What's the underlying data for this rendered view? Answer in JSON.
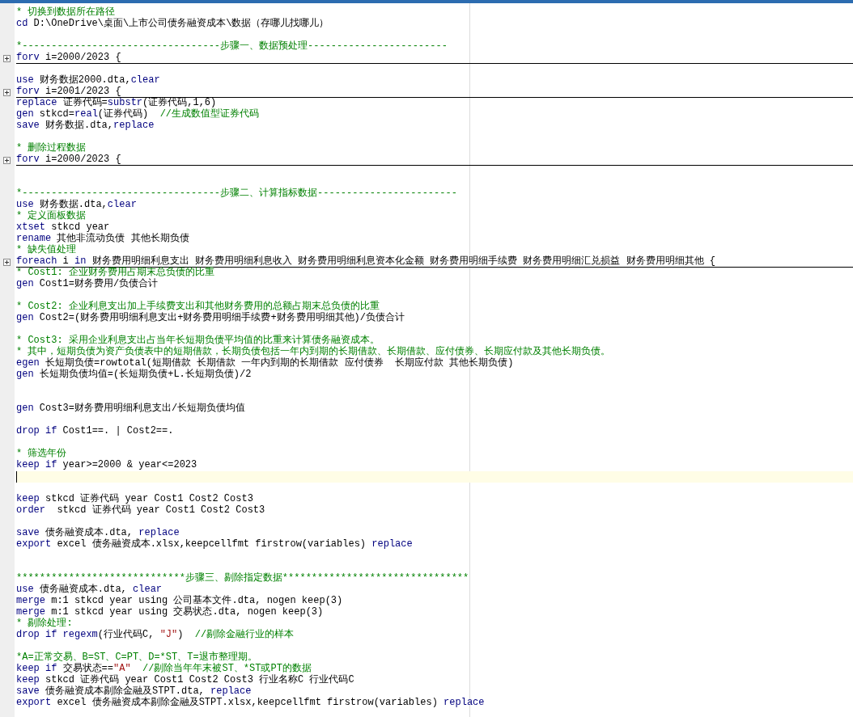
{
  "editor": {
    "lines": [
      {
        "kind": "code",
        "collapsed": false,
        "current": false,
        "segments": [
          {
            "kind": "comment",
            "text": "* 切换到数据所在路径"
          }
        ]
      },
      {
        "kind": "code",
        "collapsed": false,
        "current": false,
        "segments": [
          {
            "kind": "keyword",
            "text": "cd"
          },
          {
            "kind": "text",
            "text": " D:\\OneDrive\\桌面\\上市公司债务融资成本\\数据（存哪儿找哪儿）"
          }
        ]
      },
      {
        "kind": "blank",
        "current": false
      },
      {
        "kind": "code",
        "collapsed": false,
        "current": false,
        "segments": [
          {
            "kind": "comment",
            "text": "*----------------------------------步骤一、数据预处理------------------------"
          }
        ]
      },
      {
        "kind": "code",
        "collapsed": true,
        "current": false,
        "segments": [
          {
            "kind": "keyword",
            "text": "forv"
          },
          {
            "kind": "text",
            "text": " i=2000/2023 {"
          }
        ]
      },
      {
        "kind": "blank",
        "current": false
      },
      {
        "kind": "code",
        "collapsed": false,
        "current": false,
        "segments": [
          {
            "kind": "keyword",
            "text": "use"
          },
          {
            "kind": "text",
            "text": " 财务数据2000.dta,"
          },
          {
            "kind": "keyword",
            "text": "clear"
          }
        ]
      },
      {
        "kind": "code",
        "collapsed": true,
        "current": false,
        "segments": [
          {
            "kind": "keyword",
            "text": "forv"
          },
          {
            "kind": "text",
            "text": " i=2001/2023 {"
          }
        ]
      },
      {
        "kind": "code",
        "collapsed": false,
        "current": false,
        "segments": [
          {
            "kind": "keyword",
            "text": "replace"
          },
          {
            "kind": "text",
            "text": " 证券代码="
          },
          {
            "kind": "keyword",
            "text": "substr"
          },
          {
            "kind": "text",
            "text": "(证券代码,1,6)"
          }
        ]
      },
      {
        "kind": "code",
        "collapsed": false,
        "current": false,
        "segments": [
          {
            "kind": "keyword",
            "text": "gen"
          },
          {
            "kind": "text",
            "text": " stkcd="
          },
          {
            "kind": "keyword",
            "text": "real"
          },
          {
            "kind": "text",
            "text": "(证券代码)  "
          },
          {
            "kind": "comment",
            "text": "//生成数值型证券代码"
          }
        ]
      },
      {
        "kind": "code",
        "collapsed": false,
        "current": false,
        "segments": [
          {
            "kind": "keyword",
            "text": "save"
          },
          {
            "kind": "text",
            "text": " 财务数据.dta,"
          },
          {
            "kind": "keyword",
            "text": "replace"
          }
        ]
      },
      {
        "kind": "blank",
        "current": false
      },
      {
        "kind": "code",
        "collapsed": false,
        "current": false,
        "segments": [
          {
            "kind": "comment",
            "text": "* 删除过程数据"
          }
        ]
      },
      {
        "kind": "code",
        "collapsed": true,
        "current": false,
        "segments": [
          {
            "kind": "keyword",
            "text": "forv"
          },
          {
            "kind": "text",
            "text": " i=2000/2023 {"
          }
        ]
      },
      {
        "kind": "blank",
        "current": false
      },
      {
        "kind": "blank",
        "current": false
      },
      {
        "kind": "code",
        "collapsed": false,
        "current": false,
        "segments": [
          {
            "kind": "comment",
            "text": "*----------------------------------步骤二、计算指标数据------------------------"
          }
        ]
      },
      {
        "kind": "code",
        "collapsed": false,
        "current": false,
        "segments": [
          {
            "kind": "keyword",
            "text": "use"
          },
          {
            "kind": "text",
            "text": " 财务数据.dta,"
          },
          {
            "kind": "keyword",
            "text": "clear"
          }
        ]
      },
      {
        "kind": "code",
        "collapsed": false,
        "current": false,
        "segments": [
          {
            "kind": "comment",
            "text": "* 定义面板数据"
          }
        ]
      },
      {
        "kind": "code",
        "collapsed": false,
        "current": false,
        "segments": [
          {
            "kind": "keyword",
            "text": "xtset"
          },
          {
            "kind": "text",
            "text": " stkcd year"
          }
        ]
      },
      {
        "kind": "code",
        "collapsed": false,
        "current": false,
        "segments": [
          {
            "kind": "keyword",
            "text": "rename"
          },
          {
            "kind": "text",
            "text": " 其他非流动负债 其他长期负债"
          }
        ]
      },
      {
        "kind": "code",
        "collapsed": false,
        "current": false,
        "segments": [
          {
            "kind": "comment",
            "text": "* 缺失值处理"
          }
        ]
      },
      {
        "kind": "code",
        "collapsed": true,
        "current": false,
        "segments": [
          {
            "kind": "keyword",
            "text": "foreach"
          },
          {
            "kind": "text",
            "text": " i "
          },
          {
            "kind": "keyword",
            "text": "in"
          },
          {
            "kind": "text",
            "text": " 财务费用明细利息支出 财务费用明细利息收入 财务费用明细利息资本化金额 财务费用明细手续费 财务费用明细汇兑损益 财务费用明细其他 {"
          }
        ]
      },
      {
        "kind": "code",
        "collapsed": false,
        "current": false,
        "segments": [
          {
            "kind": "comment",
            "text": "* Cost1: 企业财务费用占期末总负债的比重"
          }
        ]
      },
      {
        "kind": "code",
        "collapsed": false,
        "current": false,
        "segments": [
          {
            "kind": "keyword",
            "text": "gen"
          },
          {
            "kind": "text",
            "text": " Cost1=财务费用/负债合计"
          }
        ]
      },
      {
        "kind": "blank",
        "current": false
      },
      {
        "kind": "code",
        "collapsed": false,
        "current": false,
        "segments": [
          {
            "kind": "comment",
            "text": "* Cost2: 企业利息支出加上手续费支出和其他财务费用的总额占期末总负债的比重"
          }
        ]
      },
      {
        "kind": "code",
        "collapsed": false,
        "current": false,
        "segments": [
          {
            "kind": "keyword",
            "text": "gen"
          },
          {
            "kind": "text",
            "text": " Cost2=(财务费用明细利息支出+财务费用明细手续费+财务费用明细其他)/负债合计"
          }
        ]
      },
      {
        "kind": "blank",
        "current": false
      },
      {
        "kind": "code",
        "collapsed": false,
        "current": false,
        "segments": [
          {
            "kind": "comment",
            "text": "* Cost3: 采用企业利息支出占当年长短期负债平均值的比重来计算债务融资成本。"
          }
        ]
      },
      {
        "kind": "code",
        "collapsed": false,
        "current": false,
        "segments": [
          {
            "kind": "comment",
            "text": "* 其中，短期负债为资产负债表中的短期借款，长期负债包括一年内到期的长期借款、长期借款、应付债券、长期应付款及其他长期负债。"
          }
        ]
      },
      {
        "kind": "code",
        "collapsed": false,
        "current": false,
        "segments": [
          {
            "kind": "keyword",
            "text": "egen"
          },
          {
            "kind": "text",
            "text": " 长短期负债=rowtotal(短期借款 长期借款 一年内到期的长期借款 应付债券  长期应付款 其他长期负债)"
          }
        ]
      },
      {
        "kind": "code",
        "collapsed": false,
        "current": false,
        "segments": [
          {
            "kind": "keyword",
            "text": "gen"
          },
          {
            "kind": "text",
            "text": " 长短期负债均值=(长短期负债+L.长短期负债)/2"
          }
        ]
      },
      {
        "kind": "blank",
        "current": false
      },
      {
        "kind": "blank",
        "current": false
      },
      {
        "kind": "code",
        "collapsed": false,
        "current": false,
        "segments": [
          {
            "kind": "keyword",
            "text": "gen"
          },
          {
            "kind": "text",
            "text": " Cost3=财务费用明细利息支出/长短期负债均值"
          }
        ]
      },
      {
        "kind": "blank",
        "current": false
      },
      {
        "kind": "code",
        "collapsed": false,
        "current": false,
        "segments": [
          {
            "kind": "keyword",
            "text": "drop if"
          },
          {
            "kind": "text",
            "text": " Cost1==. | Cost2==."
          }
        ]
      },
      {
        "kind": "blank",
        "current": false
      },
      {
        "kind": "code",
        "collapsed": false,
        "current": false,
        "segments": [
          {
            "kind": "comment",
            "text": "* 筛选年份"
          }
        ]
      },
      {
        "kind": "code",
        "collapsed": false,
        "current": false,
        "segments": [
          {
            "kind": "keyword",
            "text": "keep if"
          },
          {
            "kind": "text",
            "text": " year>=2000 & year<=2023"
          }
        ]
      },
      {
        "kind": "blank",
        "current": true
      },
      {
        "kind": "blank",
        "current": false
      },
      {
        "kind": "code",
        "collapsed": false,
        "current": false,
        "segments": [
          {
            "kind": "keyword",
            "text": "keep"
          },
          {
            "kind": "text",
            "text": " stkcd 证券代码 year Cost1 Cost2 Cost3"
          }
        ]
      },
      {
        "kind": "code",
        "collapsed": false,
        "current": false,
        "segments": [
          {
            "kind": "keyword",
            "text": "order"
          },
          {
            "kind": "text",
            "text": "  stkcd 证券代码 year Cost1 Cost2 Cost3"
          }
        ]
      },
      {
        "kind": "blank",
        "current": false
      },
      {
        "kind": "code",
        "collapsed": false,
        "current": false,
        "segments": [
          {
            "kind": "keyword",
            "text": "save"
          },
          {
            "kind": "text",
            "text": " 债务融资成本.dta, "
          },
          {
            "kind": "keyword",
            "text": "replace"
          }
        ]
      },
      {
        "kind": "code",
        "collapsed": false,
        "current": false,
        "segments": [
          {
            "kind": "keyword",
            "text": "export"
          },
          {
            "kind": "text",
            "text": " excel 债务融资成本.xlsx,keepcellfmt firstrow(variables) "
          },
          {
            "kind": "keyword",
            "text": "replace"
          }
        ]
      },
      {
        "kind": "blank",
        "current": false
      },
      {
        "kind": "blank",
        "current": false
      },
      {
        "kind": "code",
        "collapsed": false,
        "current": false,
        "segments": [
          {
            "kind": "comment",
            "text": "*****************************步骤三、剔除指定数据********************************"
          }
        ]
      },
      {
        "kind": "code",
        "collapsed": false,
        "current": false,
        "segments": [
          {
            "kind": "keyword",
            "text": "use"
          },
          {
            "kind": "text",
            "text": " 债务融资成本.dta, "
          },
          {
            "kind": "keyword",
            "text": "clear"
          }
        ]
      },
      {
        "kind": "code",
        "collapsed": false,
        "current": false,
        "segments": [
          {
            "kind": "keyword",
            "text": "merge"
          },
          {
            "kind": "text",
            "text": " m:1 stkcd year using 公司基本文件.dta, nogen keep(3)"
          }
        ]
      },
      {
        "kind": "code",
        "collapsed": false,
        "current": false,
        "segments": [
          {
            "kind": "keyword",
            "text": "merge"
          },
          {
            "kind": "text",
            "text": " m:1 stkcd year using 交易状态.dta, nogen keep(3)"
          }
        ]
      },
      {
        "kind": "code",
        "collapsed": false,
        "current": false,
        "segments": [
          {
            "kind": "comment",
            "text": "* 剔除处理:"
          }
        ]
      },
      {
        "kind": "code",
        "collapsed": false,
        "current": false,
        "segments": [
          {
            "kind": "keyword",
            "text": "drop if regexm"
          },
          {
            "kind": "text",
            "text": "(行业代码C, "
          },
          {
            "kind": "string",
            "text": "\"J\""
          },
          {
            "kind": "text",
            "text": ")  "
          },
          {
            "kind": "comment",
            "text": "//剔除金融行业的样本"
          }
        ]
      },
      {
        "kind": "blank",
        "current": false
      },
      {
        "kind": "code",
        "collapsed": false,
        "current": false,
        "segments": [
          {
            "kind": "comment",
            "text": "*A=正常交易、B=ST、C=PT、D=*ST、T=退市整理期。"
          }
        ]
      },
      {
        "kind": "code",
        "collapsed": false,
        "current": false,
        "segments": [
          {
            "kind": "keyword",
            "text": "keep if"
          },
          {
            "kind": "text",
            "text": " 交易状态=="
          },
          {
            "kind": "string",
            "text": "\"A\""
          },
          {
            "kind": "comment",
            "text": "  //剔除当年年末被ST、*ST或PT的数据"
          }
        ]
      },
      {
        "kind": "code",
        "collapsed": false,
        "current": false,
        "segments": [
          {
            "kind": "keyword",
            "text": "keep"
          },
          {
            "kind": "text",
            "text": " stkcd 证券代码 year Cost1 Cost2 Cost3 行业名称C 行业代码C"
          }
        ]
      },
      {
        "kind": "code",
        "collapsed": false,
        "current": false,
        "segments": [
          {
            "kind": "keyword",
            "text": "save"
          },
          {
            "kind": "text",
            "text": " 债务融资成本剔除金融及STPT.dta, "
          },
          {
            "kind": "keyword",
            "text": "replace"
          }
        ]
      },
      {
        "kind": "code",
        "collapsed": false,
        "current": false,
        "segments": [
          {
            "kind": "keyword",
            "text": "export"
          },
          {
            "kind": "text",
            "text": " excel 债务融资成本剔除金融及STPT.xlsx,keepcellfmt firstrow(variables) "
          },
          {
            "kind": "keyword",
            "text": "replace"
          }
        ]
      }
    ]
  }
}
